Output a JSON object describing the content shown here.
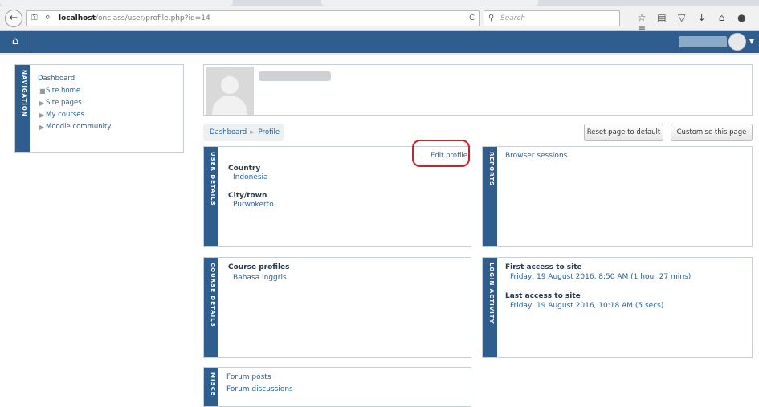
{
  "browser": {
    "url_host": "localhost",
    "url_path": "/onclass/user/profile.php?id=14",
    "search_placeholder": "Search",
    "icons": [
      "back-icon",
      "key-icon",
      "globe-icon",
      "reload-icon",
      "search-icon",
      "star-icon",
      "clipboard-icon",
      "pocket-icon",
      "download-icon",
      "home-icon",
      "chat-icon",
      "menu-icon"
    ]
  },
  "navbar": {
    "home_icon": "home-icon"
  },
  "navigation_block": {
    "title": "NAVIGATION",
    "items": [
      {
        "label": "Dashboard"
      },
      {
        "label": "Site home"
      },
      {
        "label": "Site pages"
      },
      {
        "label": "My courses"
      },
      {
        "label": "Moodle community"
      }
    ]
  },
  "breadcrumb": {
    "root": "Dashboard",
    "sep": "►",
    "current": "Profile"
  },
  "buttons": {
    "reset": "Reset page to default",
    "customise": "Customise this page"
  },
  "user_details": {
    "title": "USER DETAILS",
    "edit": "Edit profile",
    "country_label": "Country",
    "country_value": "Indonesia",
    "city_label": "City/town",
    "city_value": "Purwokerto"
  },
  "reports": {
    "title": "REPORTS",
    "browser_sessions": "Browser sessions"
  },
  "course_details": {
    "title": "COURSE DETAILS",
    "label": "Course profiles",
    "course": "Bahasa Inggris"
  },
  "login_activity": {
    "title": "LOGIN ACTIVITY",
    "first_label": "First access to site",
    "first_value": "Friday, 19 August 2016, 8:50 AM  (1 hour 27 mins)",
    "last_label": "Last access to site",
    "last_value": "Friday, 19 August 2016, 10:18 AM  (5 secs)"
  },
  "misc": {
    "title": "MISCE",
    "forum_posts": "Forum posts",
    "forum_discussions": "Forum discussions"
  },
  "colors": {
    "moodle_blue": "#2e5d8e",
    "link": "#2a6296",
    "highlight": "#d21f26"
  }
}
